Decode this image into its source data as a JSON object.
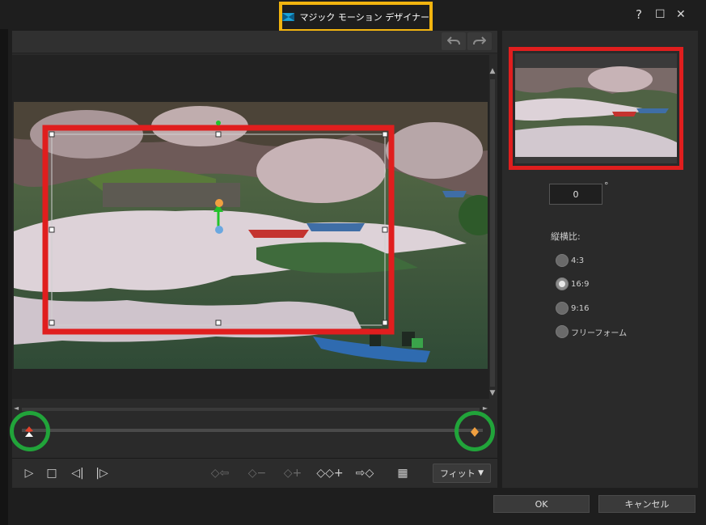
{
  "window": {
    "title": "マジック モーション デザイナー",
    "help_label": "?",
    "maximize_label": "☐",
    "close_label": "✕"
  },
  "editor": {
    "undo_icon": "undo-arrow",
    "redo_icon": "redo-arrow",
    "scroll_up": "▲",
    "scroll_down": "▼",
    "hscroll_left": "◄",
    "hscroll_right": "►"
  },
  "toolbar": {
    "play": "▷",
    "stop": "□",
    "prev_frame": "◁|",
    "next_frame": "|▷",
    "remove_prev_key": "◇⇦",
    "key_minus": "◇−",
    "key_plus": "◇+",
    "add_key": "◇◇+",
    "next_key": "⇨◇",
    "safe_area": "▦",
    "fit_label": "フィット",
    "fit_arrow": "▼"
  },
  "right_panel": {
    "rotation_value": "0",
    "degree_symbol": "°",
    "aspect_label": "縦横比:",
    "aspect_options": [
      {
        "label": "4:3",
        "checked": false
      },
      {
        "label": "16:9",
        "checked": true
      },
      {
        "label": "9:16",
        "checked": false
      },
      {
        "label": "フリーフォーム",
        "checked": false
      }
    ]
  },
  "buttons": {
    "ok": "OK",
    "cancel": "キャンセル"
  },
  "colors": {
    "highlight_title": "#f2b40f",
    "highlight_frame": "#e01e1e",
    "highlight_keyframe": "#21a43a"
  }
}
